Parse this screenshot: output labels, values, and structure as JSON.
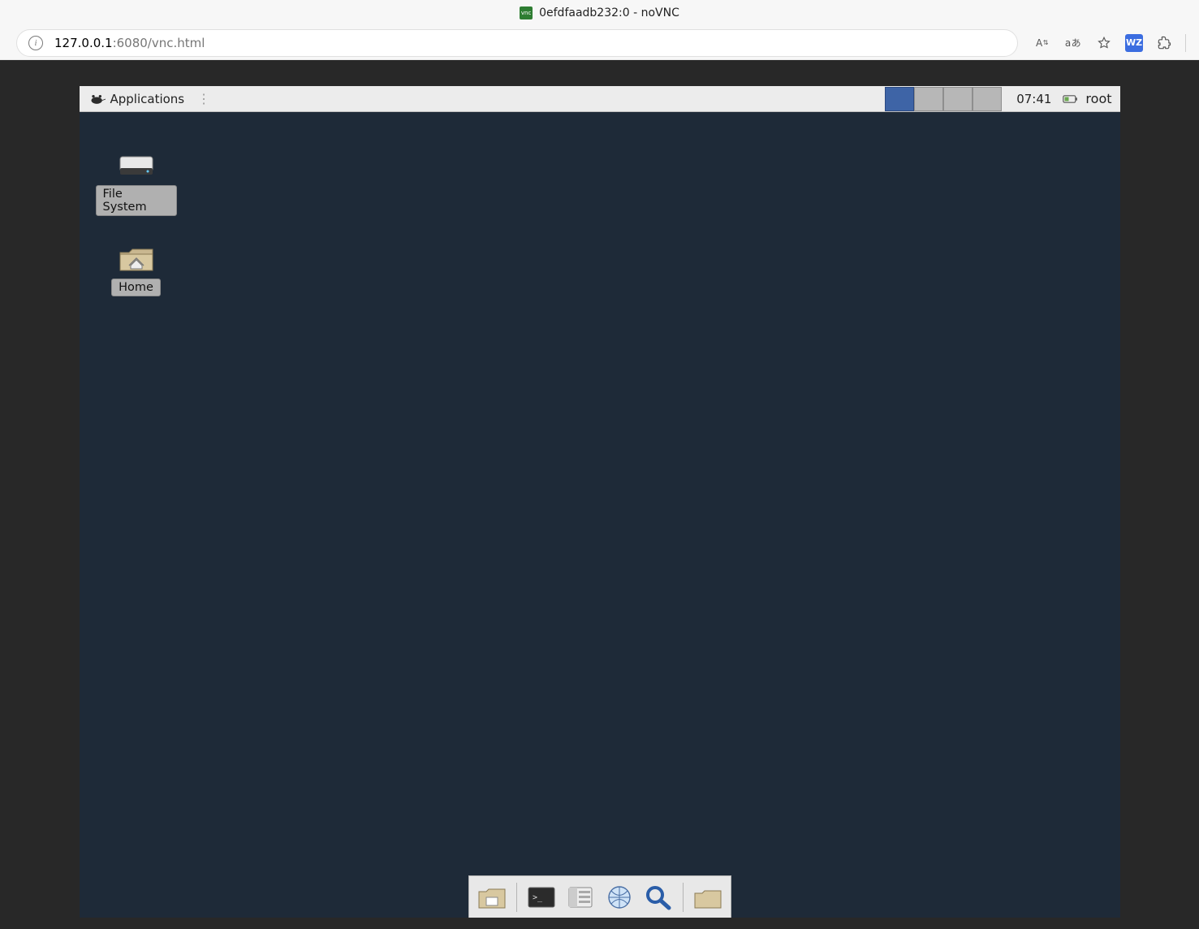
{
  "browser": {
    "favicon_text": "vnc",
    "title": "0efdfaadb232:0 - noVNC",
    "address_host": "127.0.0.1",
    "address_path": ":6080/vnc.html",
    "toolbar": {
      "text_size_label": "A",
      "translate_label": "aあ",
      "wz_label": "WZ"
    }
  },
  "desktop": {
    "panel": {
      "applications_label": "Applications",
      "workspaces": 4,
      "active_workspace": 1,
      "clock": "07:41",
      "user": "root"
    },
    "icons": {
      "file_system": "File System",
      "home": "Home"
    },
    "dock_items": [
      "show-desktop",
      "terminal",
      "file-manager",
      "web-browser",
      "search",
      "home-folder"
    ]
  }
}
